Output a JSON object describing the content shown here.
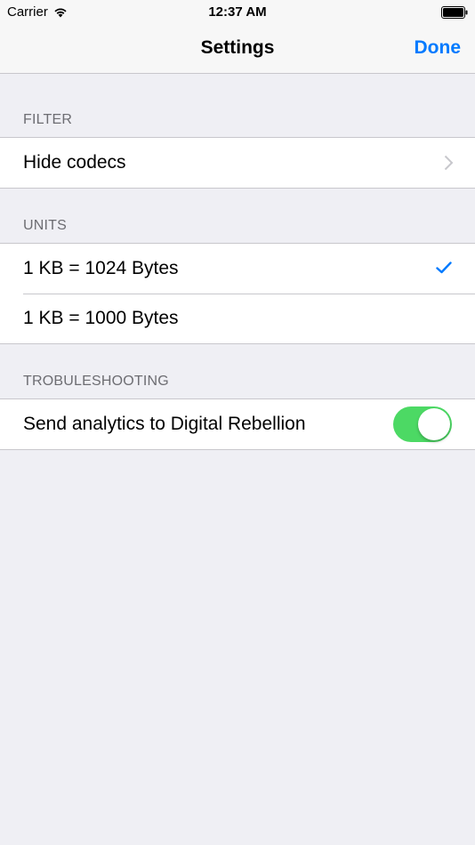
{
  "status_bar": {
    "carrier": "Carrier",
    "time": "12:37 AM"
  },
  "nav": {
    "title": "Settings",
    "done_label": "Done"
  },
  "sections": {
    "filter": {
      "header": "FILTER",
      "hide_codecs": "Hide codecs"
    },
    "units": {
      "header": "UNITS",
      "kb_1024": "1 KB = 1024 Bytes",
      "kb_1000": "1 KB = 1000 Bytes",
      "selected": "1 KB = 1024 Bytes"
    },
    "troubleshooting": {
      "header": "TROBULESHOOTING",
      "analytics_label": "Send analytics to Digital Rebellion",
      "analytics_enabled": true
    }
  },
  "colors": {
    "accent": "#007aff",
    "toggle_on": "#4cd964",
    "background": "#efeff4"
  }
}
